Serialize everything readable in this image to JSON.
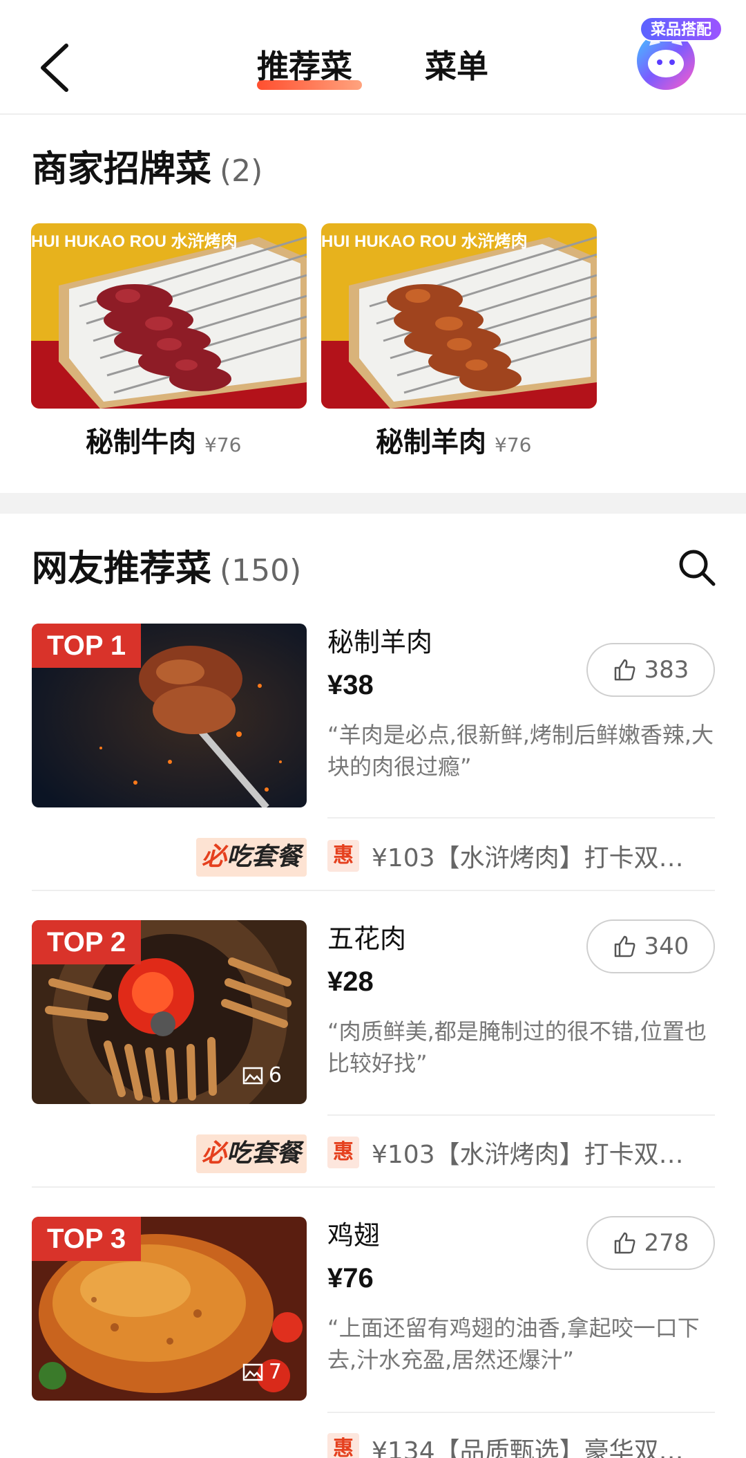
{
  "header": {
    "tabs": [
      {
        "label": "推荐菜",
        "active": true
      },
      {
        "label": "菜单",
        "active": false
      }
    ],
    "assistant_badge": "菜品搭配",
    "accent_color": "#ff4f2f"
  },
  "signature": {
    "title": "商家招牌菜",
    "count": "(2)",
    "items": [
      {
        "name": "秘制牛肉",
        "price": "¥76",
        "image_text": "HUI HUKAO ROU 水浒烤肉"
      },
      {
        "name": "秘制羊肉",
        "price": "¥76",
        "image_text": "HUI HUKAO ROU 水浒烤肉"
      }
    ]
  },
  "recommended": {
    "title": "网友推荐菜",
    "count": "(150)",
    "items": [
      {
        "rank": "TOP 1",
        "name": "秘制羊肉",
        "price": "¥38",
        "likes": "383",
        "review": "“羊肉是必点,很新鲜,烤制后鲜嫩香辣,大块的肉很过瘾”",
        "photo_count": "",
        "combo_label": "必吃套餐",
        "deal_tag": "惠",
        "deal_text": "¥103【水浒烤肉】打卡双…"
      },
      {
        "rank": "TOP 2",
        "name": "五花肉",
        "price": "¥28",
        "likes": "340",
        "review": "“肉质鲜美,都是腌制过的很不错,位置也比较好找”",
        "photo_count": "6",
        "combo_label": "必吃套餐",
        "deal_tag": "惠",
        "deal_text": "¥103【水浒烤肉】打卡双…"
      },
      {
        "rank": "TOP 3",
        "name": "鸡翅",
        "price": "¥76",
        "likes": "278",
        "review": "“上面还留有鸡翅的油香,拿起咬一口下去,汁水充盈,居然还爆汁”",
        "photo_count": "7",
        "combo_label": "",
        "deal_tag": "惠",
        "deal_text": "¥134【品质甄选】豪华双…"
      }
    ]
  }
}
